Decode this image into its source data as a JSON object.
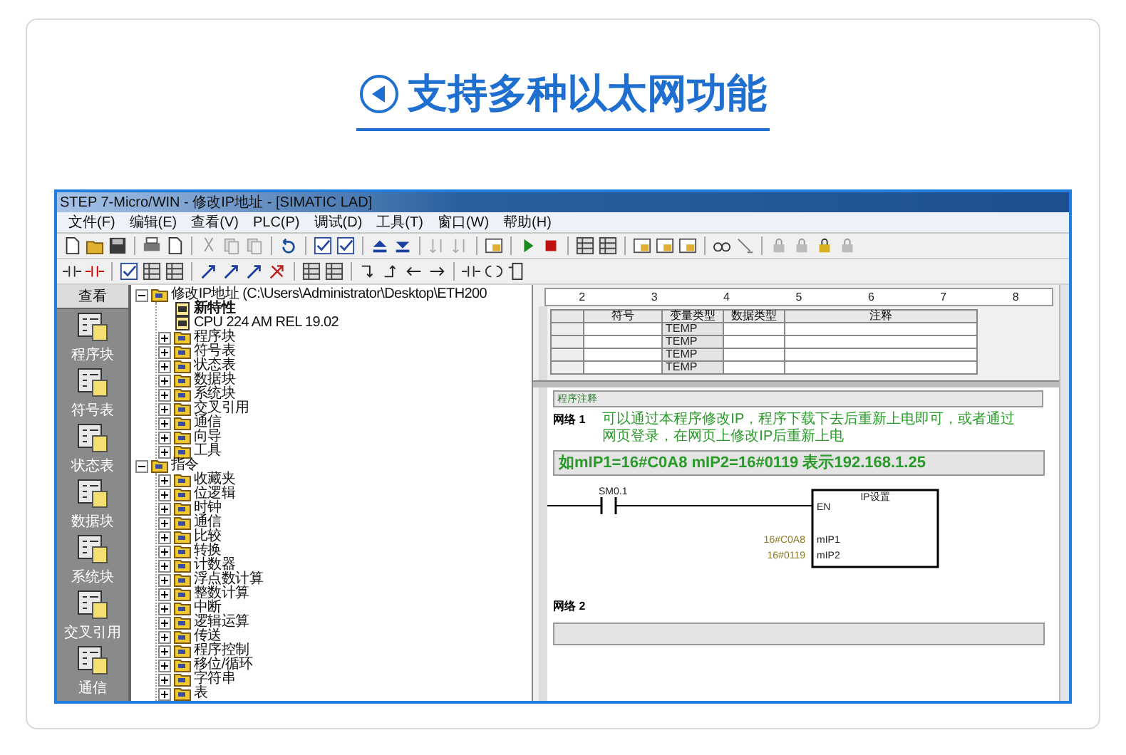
{
  "page": {
    "title": "支持多种以太网功能"
  },
  "window": {
    "title": "STEP 7-Micro/WIN - 修改IP地址 - [SIMATIC LAD]"
  },
  "menu": [
    "文件(F)",
    "编辑(E)",
    "查看(V)",
    "PLC(P)",
    "调试(D)",
    "工具(T)",
    "窗口(W)",
    "帮助(H)"
  ],
  "sidebar": {
    "header": "查看",
    "items": [
      {
        "label": "程序块"
      },
      {
        "label": "符号表"
      },
      {
        "label": "状态表"
      },
      {
        "label": "数据块"
      },
      {
        "label": "系统块"
      },
      {
        "label": "交叉引用"
      },
      {
        "label": "通信"
      }
    ]
  },
  "tree": [
    {
      "label": "修改IP地址 (C:\\Users\\Administrator\\Desktop\\ETH200",
      "expanded": true,
      "children": [
        {
          "label": "新特性"
        },
        {
          "label": "CPU 224 AM REL 19.02"
        },
        {
          "label": "程序块",
          "expanded": false
        },
        {
          "label": "符号表",
          "expanded": false
        },
        {
          "label": "状态表",
          "expanded": false
        },
        {
          "label": "数据块",
          "expanded": false
        },
        {
          "label": "系统块",
          "expanded": false
        },
        {
          "label": "交叉引用",
          "expanded": false
        },
        {
          "label": "通信",
          "expanded": false
        },
        {
          "label": "向导",
          "expanded": false
        },
        {
          "label": "工具",
          "expanded": false
        }
      ]
    },
    {
      "label": "指令",
      "expanded": true,
      "children": [
        {
          "label": "收藏夹",
          "expanded": false
        },
        {
          "label": "位逻辑",
          "expanded": false
        },
        {
          "label": "时钟",
          "expanded": false
        },
        {
          "label": "通信",
          "expanded": false
        },
        {
          "label": "比较",
          "expanded": false
        },
        {
          "label": "转换",
          "expanded": false
        },
        {
          "label": "计数器",
          "expanded": false
        },
        {
          "label": "浮点数计算",
          "expanded": false
        },
        {
          "label": "整数计算",
          "expanded": false
        },
        {
          "label": "中断",
          "expanded": false
        },
        {
          "label": "逻辑运算",
          "expanded": false
        },
        {
          "label": "传送",
          "expanded": false
        },
        {
          "label": "程序控制",
          "expanded": false
        },
        {
          "label": "移位/循环",
          "expanded": false
        },
        {
          "label": "字符串",
          "expanded": false
        },
        {
          "label": "表",
          "expanded": false
        }
      ]
    }
  ],
  "ruler": [
    "2",
    "3",
    "4",
    "5",
    "6",
    "7",
    "8"
  ],
  "variable_table": {
    "columns": [
      "符号",
      "变量类型",
      "数据类型",
      "注释"
    ],
    "rows": [
      {
        "var_type": "TEMP"
      },
      {
        "var_type": "TEMP"
      },
      {
        "var_type": "TEMP"
      },
      {
        "var_type": "TEMP"
      }
    ]
  },
  "program": {
    "comment_label": "程序注释",
    "networks": [
      {
        "label": "网络 1",
        "comment": "可以通过本程序修改IP，程序下载下去后重新上电即可，或者通过网页登录，在网页上修改IP后重新上电",
        "note": "如mIP1=16#C0A8    mIP2=16#0119 表示192.168.1.25",
        "contact": "SM0.1",
        "block": {
          "title": "IP设置",
          "en": "EN",
          "inputs": [
            {
              "pin": "mIP1",
              "value": "16#C0A8"
            },
            {
              "pin": "mIP2",
              "value": "16#0119"
            }
          ]
        }
      },
      {
        "label": "网络 2"
      }
    ]
  }
}
